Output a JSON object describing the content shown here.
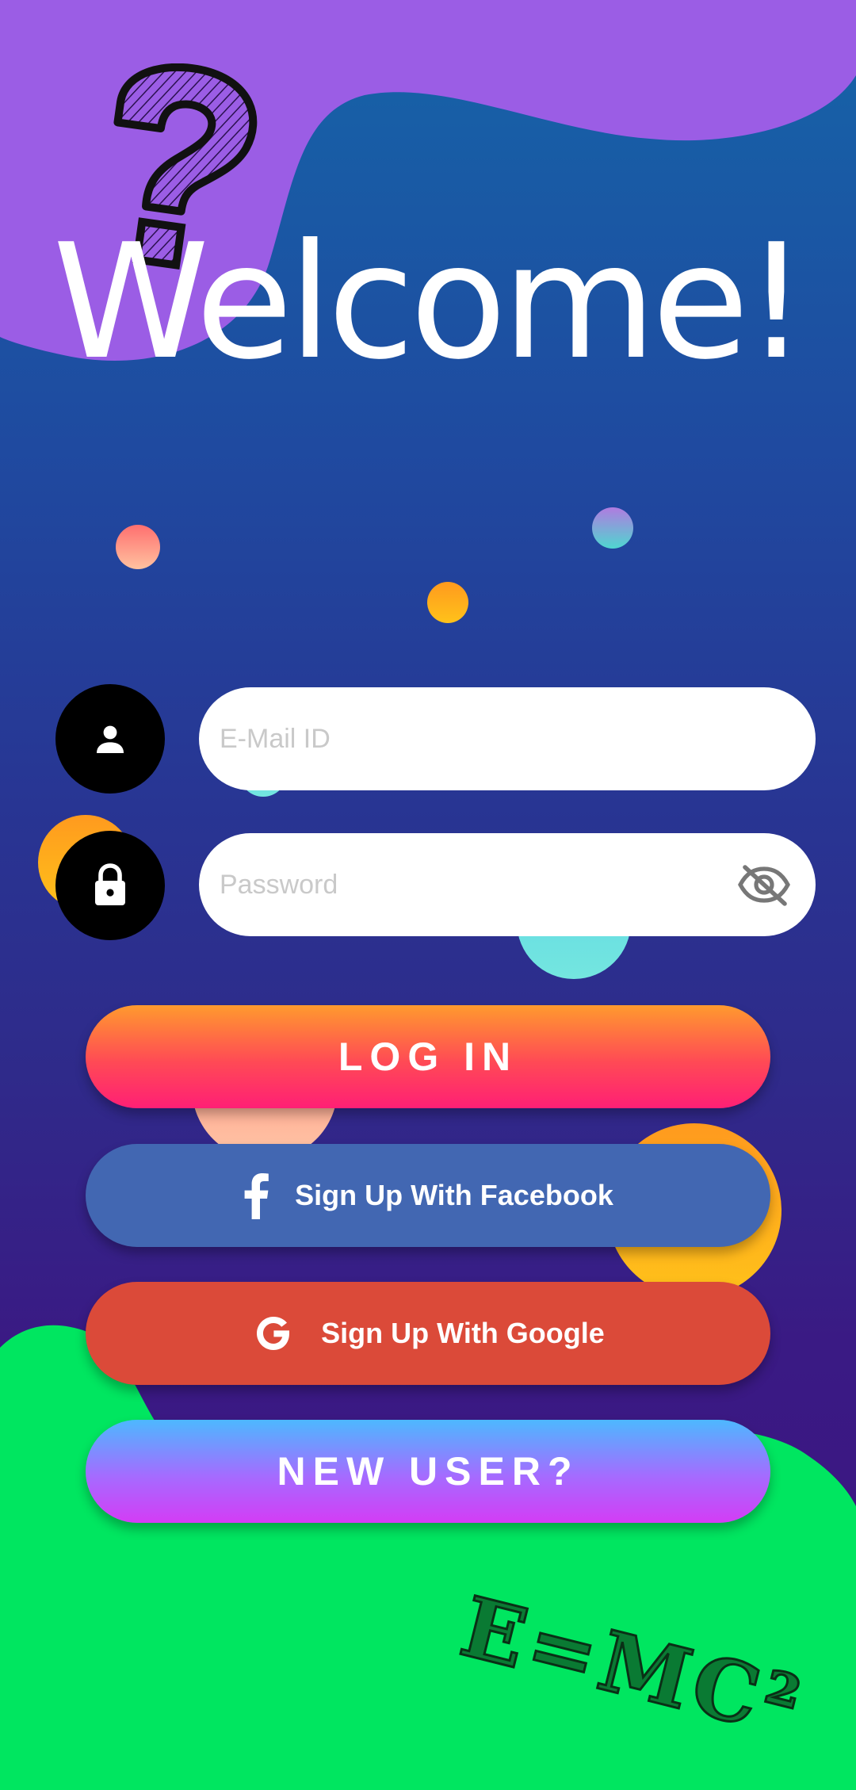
{
  "welcome": {
    "title": "Welcome!"
  },
  "decorations": {
    "question_mark": "?",
    "formula": "E=MC²"
  },
  "form": {
    "email_placeholder": "E-Mail ID",
    "email_value": "",
    "password_placeholder": "Password",
    "password_value": "",
    "email_icon": "person-icon",
    "password_icon": "lock-icon",
    "visibility_icon": "eye-off-icon"
  },
  "buttons": {
    "login": "LOG IN",
    "facebook": "Sign Up With Facebook",
    "facebook_icon": "facebook-icon",
    "google": "Sign Up With Google",
    "google_icon": "google-icon",
    "new_user": "NEW USER?"
  },
  "colors": {
    "login_gradient": [
      "#ff9a2e",
      "#ff1f75"
    ],
    "facebook": "#4267b2",
    "google": "#db4a39",
    "new_user_gradient": [
      "#4db8ff",
      "#d43cf5"
    ],
    "top_blob": "#9b5de5",
    "bottom_blob": "#00e660"
  }
}
